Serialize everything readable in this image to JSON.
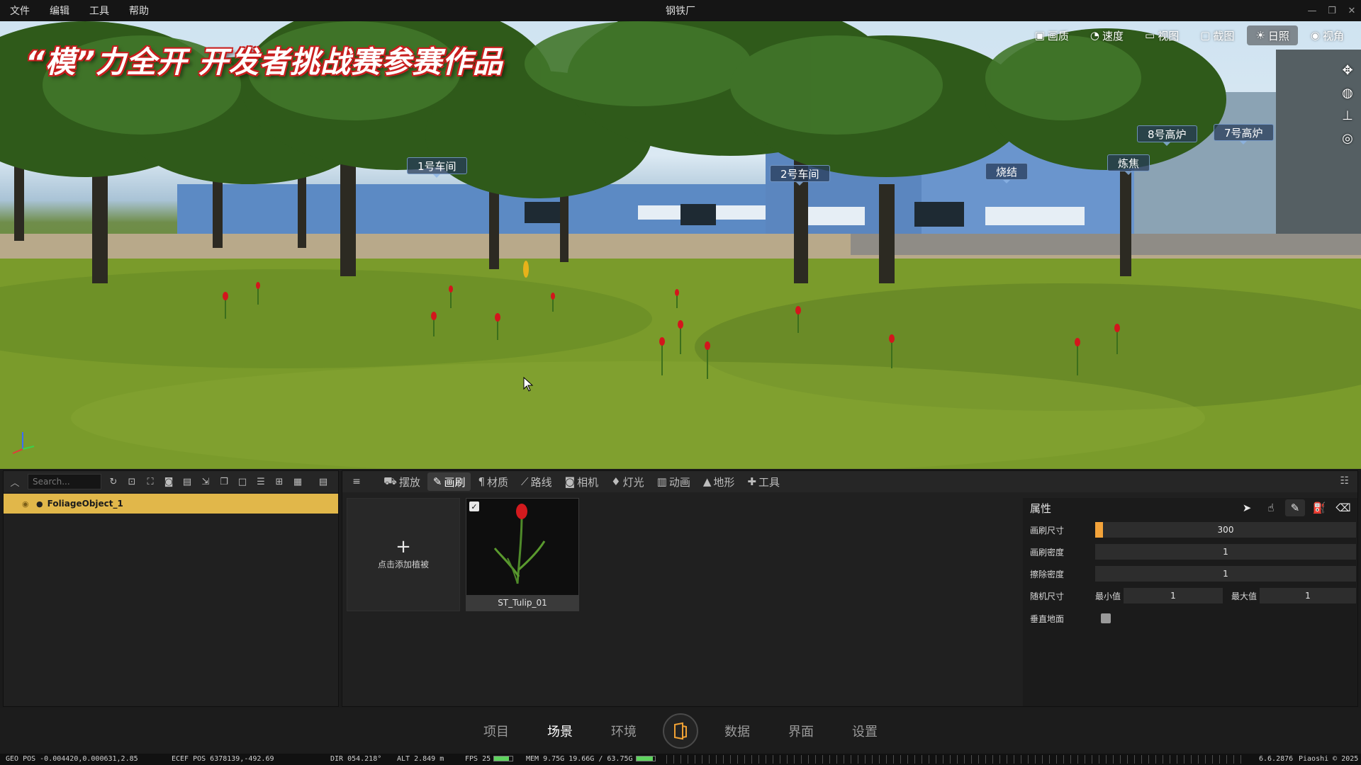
{
  "menubar": {
    "items": [
      "文件",
      "编辑",
      "工具",
      "帮助"
    ],
    "title": "钢铁厂"
  },
  "viewport": {
    "banner": "“模”力全开  开发者挑战赛参赛作品",
    "toolbar": [
      {
        "label": "画质",
        "icon": "picture-icon",
        "glyph": "▣"
      },
      {
        "label": "速度",
        "icon": "speed-icon",
        "glyph": "◔"
      },
      {
        "label": "视图",
        "icon": "video-icon",
        "glyph": "▭"
      },
      {
        "label": "截图",
        "icon": "screenshot-icon",
        "glyph": "▢"
      },
      {
        "label": "日照",
        "icon": "sun-icon",
        "glyph": "☀"
      },
      {
        "label": "视角",
        "icon": "eye-icon",
        "glyph": "◉"
      }
    ],
    "pois": [
      "1号车间",
      "2号车间",
      "烧结",
      "炼焦",
      "8号高炉",
      "7号高炉"
    ]
  },
  "outliner": {
    "search_placeholder": "Search...",
    "items": [
      {
        "name": "FoliageObject_1"
      }
    ]
  },
  "foliage": {
    "tabs": [
      {
        "label": "摆放",
        "icon": "place-icon",
        "glyph": "⛟"
      },
      {
        "label": "画刷",
        "icon": "brush-icon",
        "glyph": "✎"
      },
      {
        "label": "材质",
        "icon": "material-icon",
        "glyph": "¶"
      },
      {
        "label": "路线",
        "icon": "route-icon",
        "glyph": "⟋"
      },
      {
        "label": "相机",
        "icon": "camera-icon",
        "glyph": "◙"
      },
      {
        "label": "灯光",
        "icon": "light-icon",
        "glyph": "♦"
      },
      {
        "label": "动画",
        "icon": "animation-icon",
        "glyph": "▥"
      },
      {
        "label": "地形",
        "icon": "terrain-icon",
        "glyph": "▲"
      },
      {
        "label": "工具",
        "icon": "wrench-icon",
        "glyph": "✚"
      }
    ],
    "active_tab": "画刷",
    "add_label": "点击添加植被",
    "asset_name": "ST_Tulip_01",
    "properties": {
      "title": "属性",
      "brush_size_label": "画刷尺寸",
      "brush_size": "300",
      "brush_size_fraction": 0.03,
      "brush_density_label": "画刷密度",
      "brush_density": "1",
      "erase_density_label": "擦除密度",
      "erase_density": "1",
      "random_size_label": "随机尺寸",
      "min_label": "最小值",
      "min_value": "1",
      "max_label": "最大值",
      "max_value": "1",
      "vertical_label": "垂直地面"
    }
  },
  "bottom_nav": {
    "items": [
      "项目",
      "场景",
      "环境",
      "数据",
      "界面",
      "设置"
    ],
    "active": "场景"
  },
  "statusbar": {
    "geo_pos": "GEO POS  -0.004420,0.000631,2.85",
    "ecef_pos": "ECEF POS  6378139,-492.69",
    "dir": "DIR  054.218°",
    "alt": "ALT  2.849 m",
    "fps": "FPS  25",
    "mem": "MEM  9.75G  19.66G / 63.75G",
    "version": "6.6.2876",
    "copyright": "Piaoshi © 2025"
  }
}
